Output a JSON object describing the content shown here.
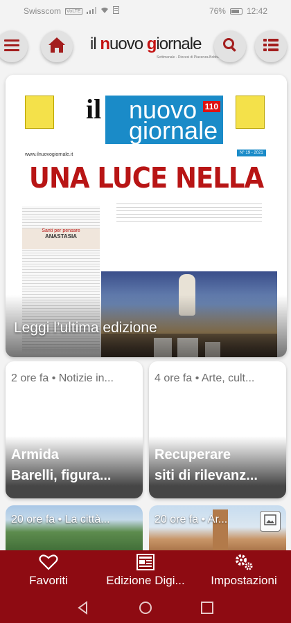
{
  "status_bar": {
    "carrier": "Swisscom",
    "carrier_tag": "VoLTE",
    "battery_percent": "76%",
    "time": "12:42"
  },
  "header": {
    "logo_il": "il ",
    "logo_n": "n",
    "logo_uovo": "uovo ",
    "logo_g": "g",
    "logo_iornale": "iornale",
    "logo_tagline": "Settimanale - Diocesi di Piacenza-Bobbio",
    "icons": {
      "menu": "menu-icon",
      "home": "home-icon",
      "search": "search-icon",
      "list": "list-icon"
    },
    "accent_color": "#a31d1d"
  },
  "hero": {
    "label": "Leggi l’ultima edizione",
    "cover": {
      "il": "il",
      "nuovo": "nuovo",
      "giornale": "giornale",
      "edition_badge": "110",
      "url": "www.ilnuovogiornale.it",
      "issue": "N° 19 - 2021",
      "headline": "UNA LUCE NELLA NOTTE",
      "column_title": "Santi per pensare",
      "column_subtitle": "ANASTASIA"
    }
  },
  "cards": [
    {
      "meta": "2 ore fa • Notizie in...",
      "title_line1": "Armida",
      "title_line2": "Barelli, figura..."
    },
    {
      "meta": "4 ore fa • Arte, cult...",
      "title_line1": "Recuperare",
      "title_line2": "siti di rilevanz..."
    },
    {
      "meta": "20 ore fa • La città..."
    },
    {
      "meta": "20 ore fa • Ar..."
    }
  ],
  "bottom_nav": {
    "items": [
      {
        "label": "Favoriti",
        "icon": "heart-icon"
      },
      {
        "label": "Edizione Digi...",
        "icon": "newspaper-icon"
      },
      {
        "label": "Impostazioni",
        "icon": "gears-icon"
      }
    ],
    "background": "#8e0b12"
  },
  "system_nav": {
    "icons": [
      "back-icon",
      "home-circle-icon",
      "recents-icon"
    ]
  }
}
